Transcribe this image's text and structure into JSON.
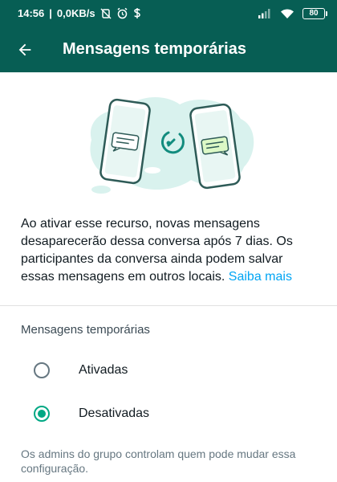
{
  "status_bar": {
    "time": "14:56",
    "separator": "|",
    "net_speed": "0,0KB/s",
    "battery": "80",
    "icons": [
      "vibrate-off-icon",
      "alarm-icon",
      "dollar-icon",
      "signal-icon",
      "wifi-icon",
      "battery-icon"
    ]
  },
  "app_bar": {
    "title": "Mensagens temporárias",
    "back_icon": "arrow-left-icon"
  },
  "illustration": {
    "icon": "timer-icon"
  },
  "description": {
    "text": "Ao ativar esse recurso, novas mensagens desaparecerão dessa conversa após 7 dias. Os participantes da conversa ainda podem salvar essas mensagens em outros locais. ",
    "link": "Saiba mais"
  },
  "section": {
    "title": "Mensagens temporárias",
    "options": [
      {
        "label": "Ativadas",
        "selected": false
      },
      {
        "label": "Desativadas",
        "selected": true
      }
    ]
  },
  "footnote": "Os admins do grupo controlam quem pode mudar essa configuração.",
  "colors": {
    "header": "#075e54",
    "accent": "#00a884",
    "link": "#00a5f4",
    "illustration_bg": "#d9f2ee"
  }
}
